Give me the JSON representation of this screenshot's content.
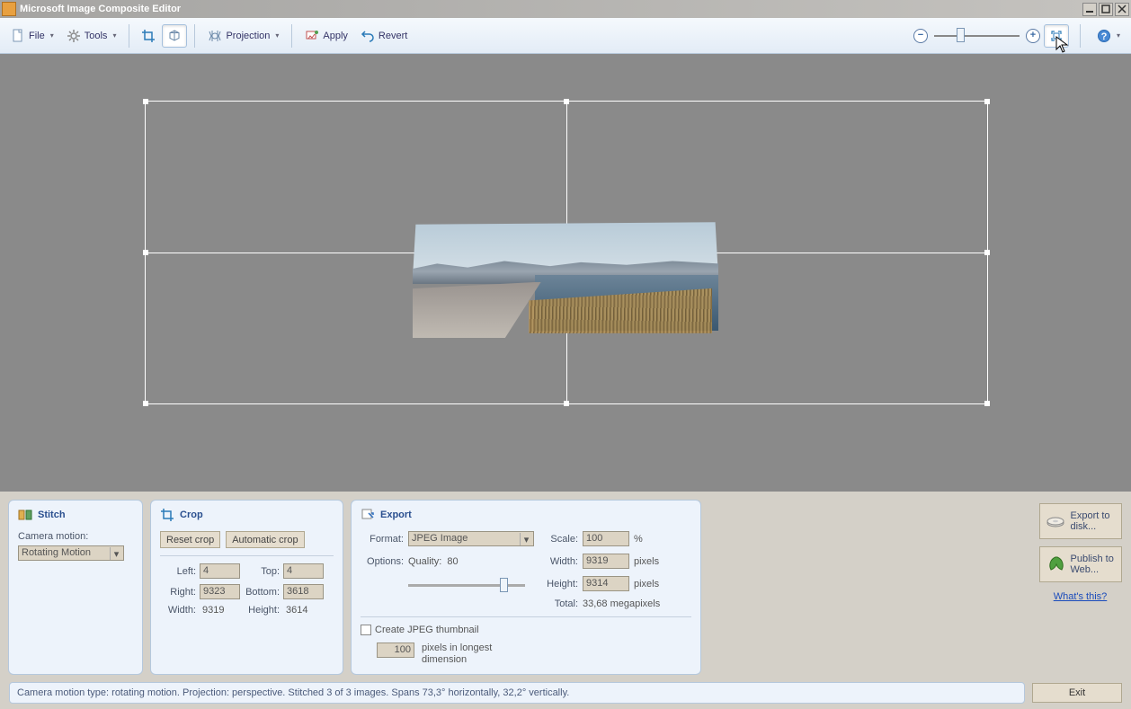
{
  "window": {
    "title": "Microsoft Image Composite Editor"
  },
  "toolbar": {
    "file": "File",
    "tools": "Tools",
    "projection": "Projection",
    "apply": "Apply",
    "revert": "Revert"
  },
  "stitch": {
    "title": "Stitch",
    "camera_motion_label": "Camera motion:",
    "camera_motion_value": "Rotating Motion"
  },
  "crop": {
    "title": "Crop",
    "reset": "Reset crop",
    "auto": "Automatic crop",
    "left_label": "Left:",
    "left": "4",
    "top_label": "Top:",
    "top": "4",
    "right_label": "Right:",
    "right": "9323",
    "bottom_label": "Bottom:",
    "bottom": "3618",
    "width_label": "Width:",
    "width": "9319",
    "height_label": "Height:",
    "height": "3614"
  },
  "export": {
    "title": "Export",
    "format_label": "Format:",
    "format_value": "JPEG Image",
    "options_label": "Options:",
    "quality_label": "Quality:",
    "quality_value": "80",
    "scale_label": "Scale:",
    "scale": "100",
    "scale_unit": "%",
    "width_label": "Width:",
    "width": "9319",
    "width_unit": "pixels",
    "height_label": "Height:",
    "height": "9314",
    "height_unit": "pixels",
    "total_label": "Total:",
    "total": "33,68 megapixels",
    "thumb_check": "Create JPEG thumbnail",
    "thumb_size": "100",
    "thumb_hint": "pixels in longest dimension"
  },
  "actions": {
    "export_disk": "Export to disk...",
    "publish_web": "Publish to Web...",
    "whats_this": "What's this?",
    "exit": "Exit"
  },
  "status": "Camera motion type: rotating motion. Projection: perspective. Stitched 3 of 3 images. Spans 73,3° horizontally, 32,2° vertically."
}
